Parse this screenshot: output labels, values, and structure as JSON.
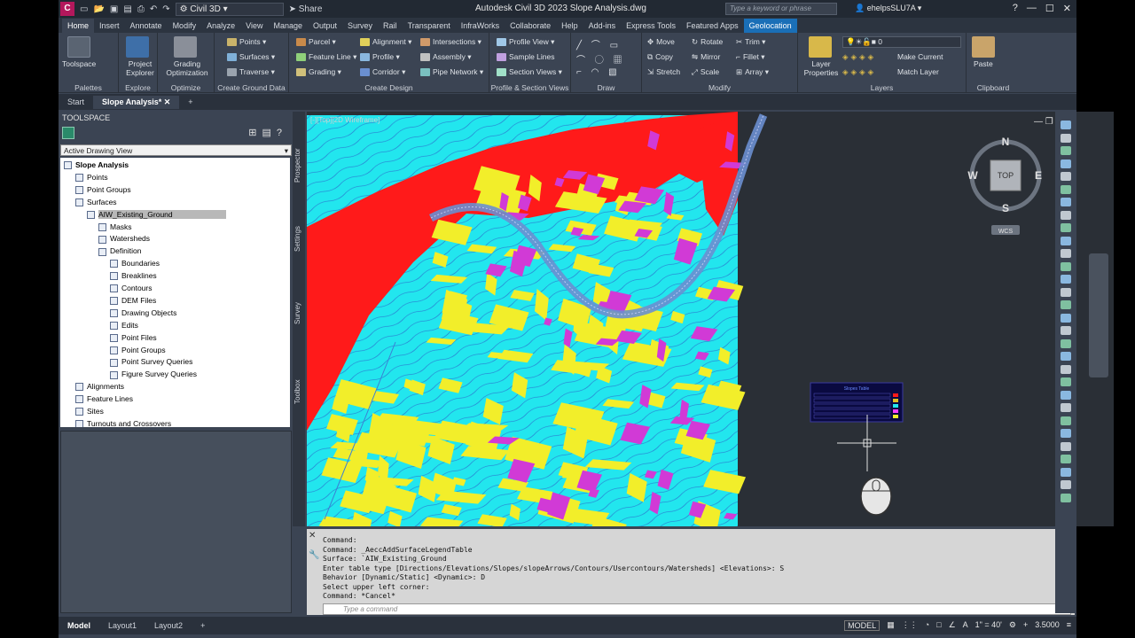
{
  "app": {
    "logo": "C",
    "logo_badge": "CIV",
    "workspace": "Civil 3D",
    "share": "Share",
    "title": "Autodesk Civil 3D 2023   Slope Analysis.dwg",
    "search_placeholder": "Type a keyword or phrase",
    "user": "ehelpsSLU7A"
  },
  "ribbon_tabs": [
    "Home",
    "Insert",
    "Annotate",
    "Modify",
    "Analyze",
    "View",
    "Manage",
    "Output",
    "Survey",
    "Rail",
    "Transparent",
    "InfraWorks",
    "Collaborate",
    "Help",
    "Add-ins",
    "Express Tools",
    "Featured Apps",
    "Geolocation"
  ],
  "ribbon": {
    "toolspace": "Toolspace",
    "project_explorer": "Project Explorer",
    "grading_optimization": "Grading Optimization",
    "points": "Points",
    "surfaces": "Surfaces",
    "traverse": "Traverse",
    "parcel": "Parcel",
    "feature_line": "Feature Line",
    "grading": "Grading",
    "alignment": "Alignment",
    "profile": "Profile",
    "corridor": "Corridor",
    "intersections": "Intersections",
    "assembly": "Assembly",
    "pipe_network": "Pipe Network",
    "profile_view": "Profile View",
    "sample_lines": "Sample Lines",
    "section_views": "Section Views",
    "move": "Move",
    "copy": "Copy",
    "stretch": "Stretch",
    "rotate": "Rotate",
    "mirror": "Mirror",
    "scale": "Scale",
    "trim": "Trim",
    "fillet": "Fillet",
    "array": "Array",
    "layer_properties": "Layer Properties",
    "layer_value": "0",
    "make_current": "Make Current",
    "match_layer": "Match Layer",
    "paste": "Paste",
    "panels": {
      "palettes": "Palettes",
      "explore": "Explore",
      "optimize": "Optimize",
      "create_ground": "Create Ground Data",
      "create_design": "Create Design",
      "profile_section": "Profile & Section Views",
      "draw": "Draw",
      "modify": "Modify",
      "layers": "Layers",
      "clipboard": "Clipboard"
    }
  },
  "doc_tabs": [
    "Start",
    "Slope Analysis*"
  ],
  "toolspace": {
    "title": "TOOLSPACE",
    "view": "Active Drawing View",
    "side_tabs": [
      "Prospector",
      "Settings",
      "Survey",
      "Toolbox"
    ],
    "tree": [
      {
        "label": "Slope Analysis",
        "level": 0
      },
      {
        "label": "Points",
        "level": 1
      },
      {
        "label": "Point Groups",
        "level": 1
      },
      {
        "label": "Surfaces",
        "level": 1
      },
      {
        "label": "AIW_Existing_Ground",
        "level": 2
      },
      {
        "label": "Masks",
        "level": 3
      },
      {
        "label": "Watersheds",
        "level": 3
      },
      {
        "label": "Definition",
        "level": 3
      },
      {
        "label": "Boundaries",
        "level": 4
      },
      {
        "label": "Breaklines",
        "level": 4
      },
      {
        "label": "Contours",
        "level": 4
      },
      {
        "label": "DEM Files",
        "level": 4
      },
      {
        "label": "Drawing Objects",
        "level": 4
      },
      {
        "label": "Edits",
        "level": 4
      },
      {
        "label": "Point Files",
        "level": 4
      },
      {
        "label": "Point Groups",
        "level": 4
      },
      {
        "label": "Point Survey Queries",
        "level": 4
      },
      {
        "label": "Figure Survey Queries",
        "level": 4
      },
      {
        "label": "Alignments",
        "level": 1
      },
      {
        "label": "Feature Lines",
        "level": 1
      },
      {
        "label": "Sites",
        "level": 1
      },
      {
        "label": "Turnouts and Crossovers",
        "level": 1
      }
    ]
  },
  "viewport": {
    "label": "[-][Top][2D Wireframe]",
    "compass": {
      "n": "N",
      "s": "S",
      "e": "E",
      "w": "W",
      "top": "TOP",
      "wcs": "WCS"
    },
    "table_title": "Slopes Table",
    "colors": {
      "cyan": "#22e6ee",
      "red": "#ff1a1a",
      "yellow": "#f2ee2a",
      "magenta": "#d13ad6",
      "contour": "#2a6acc"
    }
  },
  "command": {
    "lines": [
      "Command:",
      "Command: _AeccAddSurfaceLegendTable",
      "Surface: `AIW_Existing_Ground",
      "Enter table type [Directions/Elevations/Slopes/slopeArrows/Contours/Usercontours/Watersheds] <Elevations>: S",
      "Behavior [Dynamic/Static] <Dynamic>: D",
      "Select upper left corner:",
      "Command: *Cancel*"
    ],
    "placeholder": "Type a command"
  },
  "status": {
    "tabs": [
      "Model",
      "Layout1",
      "Layout2"
    ],
    "model": "MODEL",
    "scale": "1\" = 40'",
    "value": "3.5000"
  }
}
